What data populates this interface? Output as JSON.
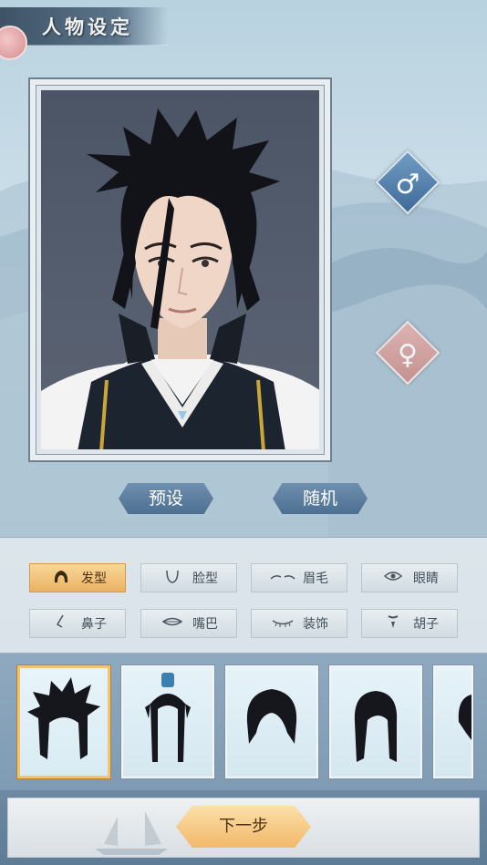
{
  "header": {
    "title": "人物设定"
  },
  "gender": {
    "male_symbol": "♂",
    "female_symbol": "♀"
  },
  "actions": {
    "preset_label": "预设",
    "random_label": "随机"
  },
  "categories": [
    {
      "label": "发型",
      "icon": "hair-icon",
      "active": true
    },
    {
      "label": "脸型",
      "icon": "face-shape-icon",
      "active": false
    },
    {
      "label": "眉毛",
      "icon": "eyebrow-icon",
      "active": false
    },
    {
      "label": "眼睛",
      "icon": "eye-icon",
      "active": false
    },
    {
      "label": "鼻子",
      "icon": "nose-icon",
      "active": false
    },
    {
      "label": "嘴巴",
      "icon": "mouth-icon",
      "active": false
    },
    {
      "label": "装饰",
      "icon": "decoration-icon",
      "active": false
    },
    {
      "label": "胡子",
      "icon": "beard-icon",
      "active": false
    }
  ],
  "hair_options": [
    {
      "name": "spiky-hair",
      "selected": true
    },
    {
      "name": "long-topknot-hair",
      "selected": false
    },
    {
      "name": "short-shaggy-hair",
      "selected": false
    },
    {
      "name": "medium-straight-hair",
      "selected": false
    },
    {
      "name": "partial-hair",
      "selected": false
    }
  ],
  "footer": {
    "next_label": "下一步"
  },
  "colors": {
    "active_category": "#eab261",
    "male_button": "#3f6a98",
    "female_button": "#c98a85",
    "next_button": "#f2b96a"
  }
}
